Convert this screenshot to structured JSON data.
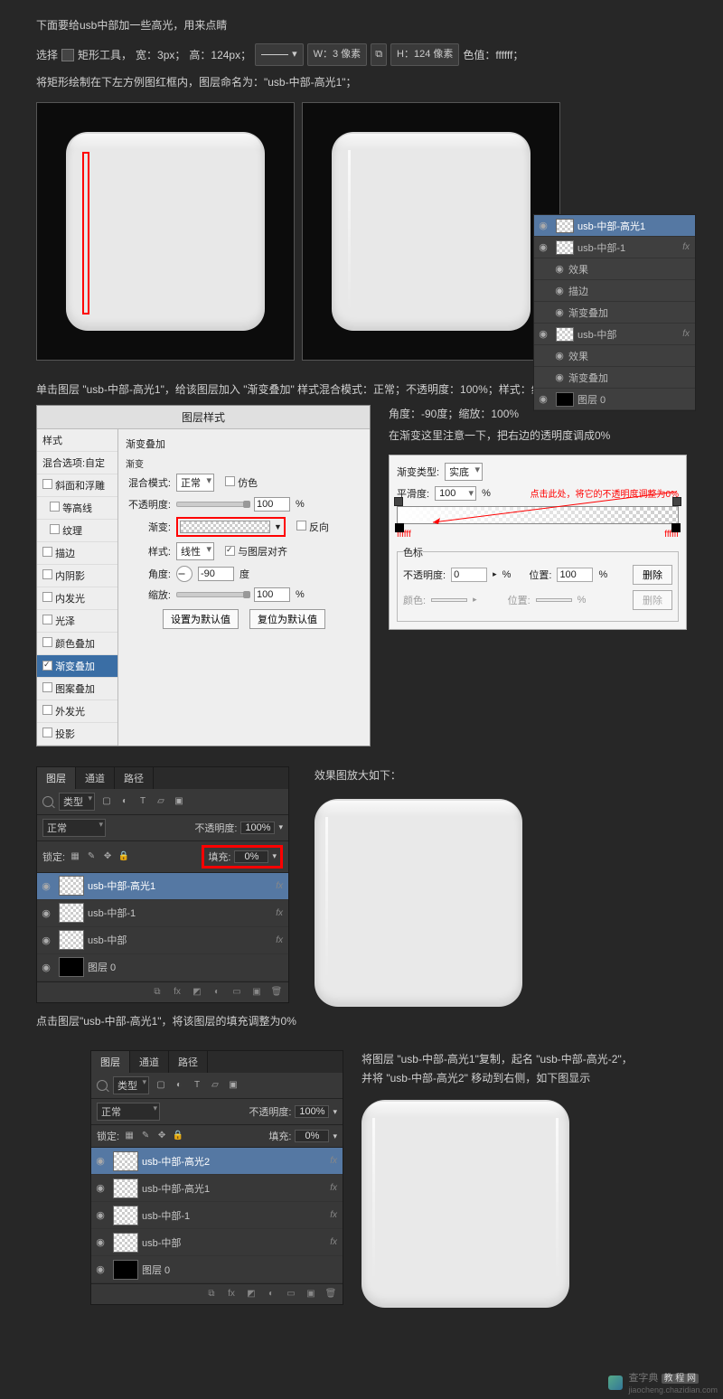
{
  "intro": {
    "line1": "下面要给usb中部加一些高光，用来点睛",
    "line2_prefix": "选择",
    "rect_tool": "矩形工具，",
    "width_label": "宽：3px；",
    "height_label": "高：124px；",
    "w_field": "W：3 像素",
    "h_field": "H：124 像素",
    "color_label": "色值：ffffff；",
    "line3": "将矩形绘制在下左方例图红框内，图层命名为：\"usb-中部-高光1\"；"
  },
  "mini_layers": {
    "items": [
      {
        "name": "usb-中部-高光1",
        "selected": true,
        "thumb": "checker",
        "fx": ""
      },
      {
        "name": "usb-中部-1",
        "selected": false,
        "thumb": "checker",
        "fx": "fx"
      },
      {
        "name": "效果",
        "indent": true,
        "noeye": true
      },
      {
        "name": "描边",
        "indent": true
      },
      {
        "name": "渐变叠加",
        "indent": true
      },
      {
        "name": "usb-中部",
        "selected": false,
        "thumb": "checker",
        "fx": "fx"
      },
      {
        "name": "效果",
        "indent": true,
        "noeye": true
      },
      {
        "name": "渐变叠加",
        "indent": true
      },
      {
        "name": "图层 0",
        "selected": false,
        "thumb": "black"
      }
    ]
  },
  "para2": {
    "line1": "单击图层 \"usb-中部-高光1\"，给该图层加入 \"渐变叠加\" 样式混合模式：正常；不透明度：100%；样式：线性；",
    "angle": "角度：-90度；缩放：100%",
    "note": "在渐变这里注意一下，把右边的透明度调成0%"
  },
  "ls": {
    "title": "图层样式",
    "left_header": "样式",
    "blend_opt": "混合选项:自定",
    "items": [
      "斜面和浮雕",
      "等高线",
      "纹理",
      "描边",
      "内阴影",
      "内发光",
      "光泽",
      "颜色叠加",
      "渐变叠加",
      "图案叠加",
      "外发光",
      "投影"
    ],
    "group_title": "渐变叠加",
    "group_sub": "渐变",
    "blend_mode_lbl": "混合模式:",
    "blend_mode_val": "正常",
    "dither": "仿色",
    "opacity_lbl": "不透明度:",
    "opacity_val": "100",
    "grad_lbl": "渐变:",
    "reverse": "反向",
    "style_lbl": "样式:",
    "style_val": "线性",
    "align": "与图层对齐",
    "angle_lbl": "角度:",
    "angle_val": "-90",
    "angle_unit": "度",
    "scale_lbl": "缩放:",
    "scale_val": "100",
    "pct": "%",
    "btn_default": "设置为默认值",
    "btn_reset": "复位为默认值"
  },
  "ge": {
    "type_lbl": "渐变类型:",
    "type_val": "实底",
    "smooth_lbl": "平滑度:",
    "smooth_val": "100",
    "annot": "点击此处，将它的不透明度调整为0%",
    "hex": "ffffff",
    "stops_title": "色标",
    "opacity_lbl": "不透明度:",
    "opacity_val": "0",
    "pos_lbl": "位置:",
    "pos_val": "100",
    "pct": "%",
    "color_lbl": "颜色:",
    "pos2_lbl": "位置:",
    "del_btn": "删除"
  },
  "dp1": {
    "tabs": [
      "图层",
      "通道",
      "路径"
    ],
    "type_lbl": "类型",
    "blend": "正常",
    "opacity_lbl": "不透明度:",
    "opacity_val": "100%",
    "lock_lbl": "锁定:",
    "fill_lbl": "填充:",
    "fill_val": "0%",
    "layers": [
      {
        "name": "usb-中部-高光1",
        "sel": true,
        "fx": "fx"
      },
      {
        "name": "usb-中部-1",
        "fx": "fx"
      },
      {
        "name": "usb-中部",
        "fx": "fx"
      },
      {
        "name": "图层 0",
        "thumb": "black"
      }
    ]
  },
  "result_caption": "效果图放大如下：",
  "para3": "点击图层\"usb-中部-高光1\"，将该图层的填充调整为0%",
  "dp2": {
    "tabs": [
      "图层",
      "通道",
      "路径"
    ],
    "type_lbl": "类型",
    "blend": "正常",
    "opacity_lbl": "不透明度:",
    "opacity_val": "100%",
    "lock_lbl": "锁定:",
    "fill_lbl": "填充:",
    "fill_val": "0%",
    "layers": [
      {
        "name": "usb-中部-高光2",
        "sel": true,
        "fx": "fx"
      },
      {
        "name": "usb-中部-高光1",
        "fx": "fx"
      },
      {
        "name": "usb-中部-1",
        "fx": "fx"
      },
      {
        "name": "usb-中部",
        "fx": "fx"
      },
      {
        "name": "图层 0",
        "thumb": "black"
      }
    ]
  },
  "para4": {
    "line1": "将图层 \"usb-中部-高光1\"复制，起名 \"usb-中部-高光-2\"，",
    "line2": "并将 \"usb-中部-高光2\" 移动到右侧，如下图显示"
  },
  "watermark": {
    "brand": "查字典",
    "tag": "教 程 网",
    "url": "jiaocheng.chazidian.com"
  }
}
